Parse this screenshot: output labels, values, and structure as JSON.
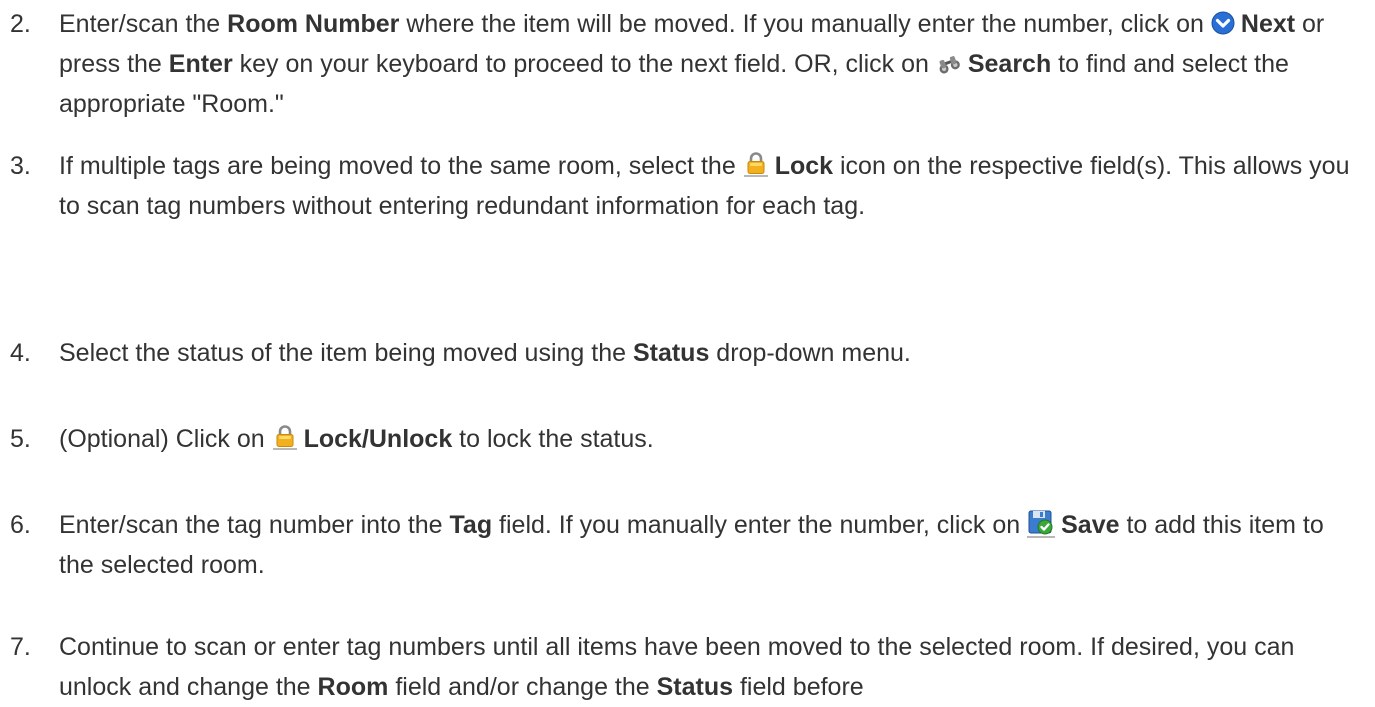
{
  "steps": [
    {
      "number": "2.",
      "parts": {
        "a": "Enter/scan the ",
        "b_room_number": "Room Number",
        "c": " where the item will be moved. If you manually enter the number, click on ",
        "d_next": "Next",
        "e": " or press the ",
        "f_enter": "Enter",
        "g": " key on your keyboard to proceed to the next field. OR, click on ",
        "h_search": "Search",
        "i": " to find and select the appropriate \"Room.\""
      }
    },
    {
      "number": "3.",
      "parts": {
        "a": "If multiple tags are being moved to the same room, select the ",
        "b_lock": "Lock",
        "c": " icon on the respective field(s). This allows you to scan tag numbers without entering redundant information for each tag."
      }
    },
    {
      "number": "4.",
      "parts": {
        "a": "Select the status of the item being moved using the ",
        "b_status": "Status",
        "c": " drop-down menu."
      }
    },
    {
      "number": "5.",
      "parts": {
        "a": "(Optional) Click on ",
        "b_lock_unlock": "Lock/Unlock",
        "c": " to lock the status."
      }
    },
    {
      "number": "6.",
      "parts": {
        "a": "Enter/scan the tag number into the ",
        "b_tag": "Tag",
        "c": " field. If you manually enter the number, click on ",
        "d_save": "Save",
        "e": " to add this item to the selected room."
      }
    },
    {
      "number": "7.",
      "parts": {
        "a": "Continue to scan or enter tag numbers until all items have been moved to the selected room. If desired, you can unlock and change the ",
        "b_room": "Room",
        "c": " field and/or change the ",
        "d_status": "Status",
        "e": " field before"
      }
    }
  ],
  "icons": {
    "next": "next-arrow-icon",
    "search": "binoculars-icon",
    "lock": "lock-icon",
    "save": "save-icon"
  },
  "colors": {
    "text": "#333333",
    "next_icon": "#2a6fd6",
    "lock_icon": "#f2b01e",
    "save_icon": "#3b7ccf",
    "save_check": "#3aa83a"
  }
}
